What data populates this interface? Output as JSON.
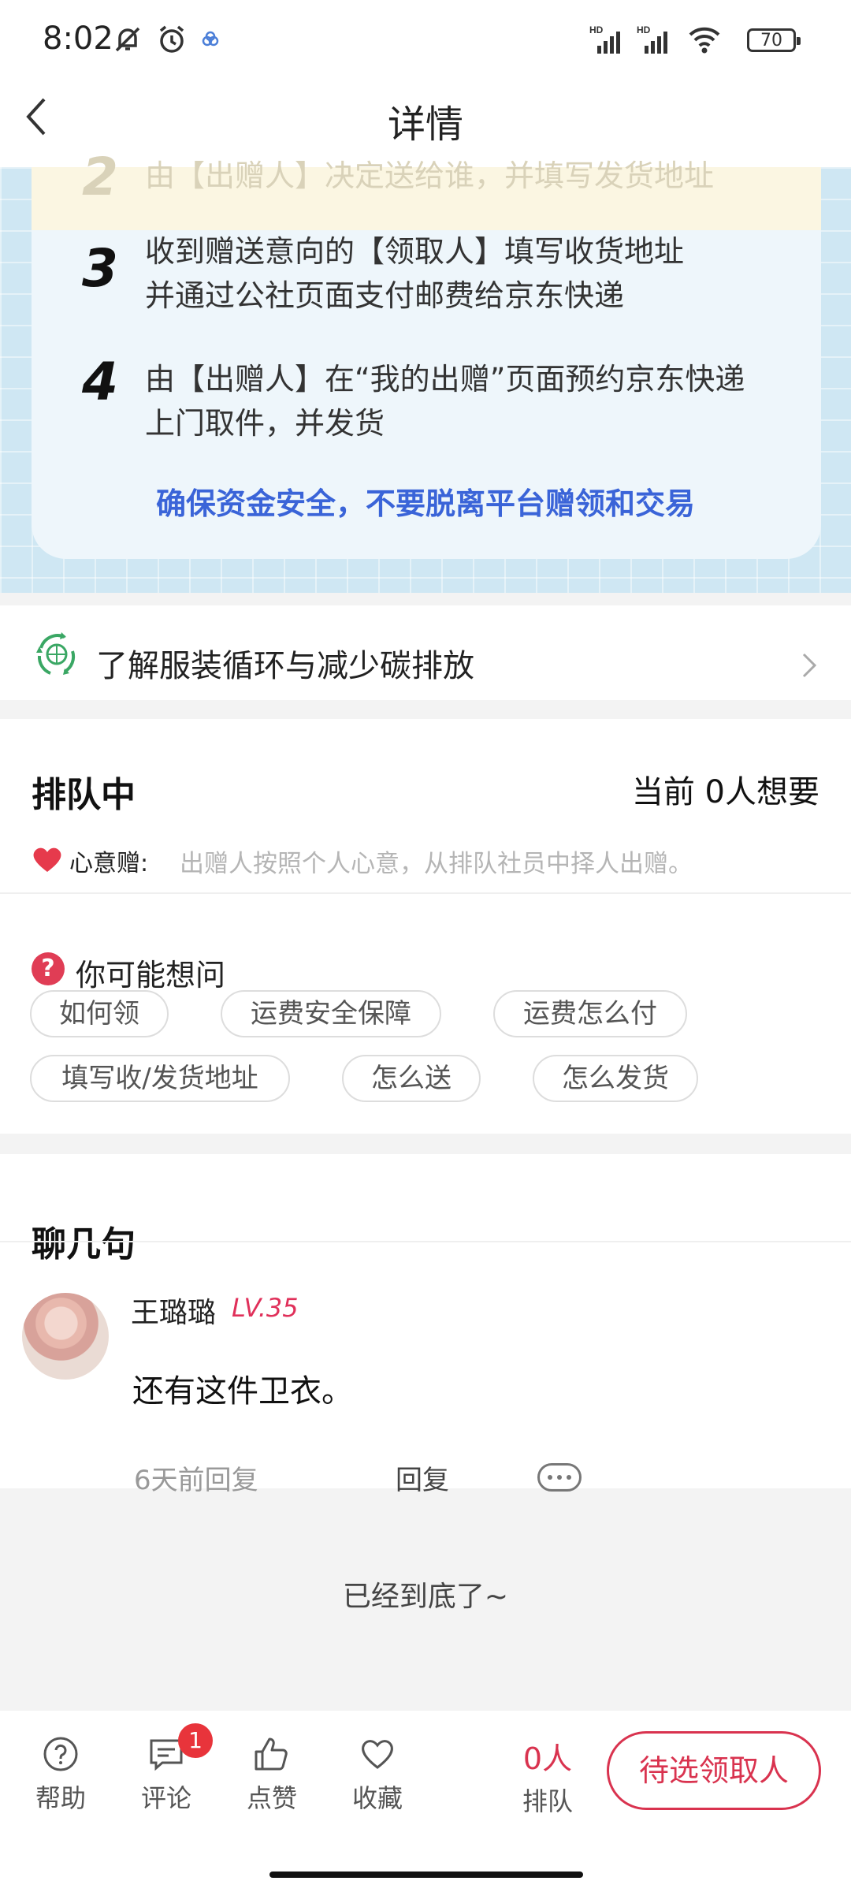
{
  "status": {
    "time": "8:02",
    "battery": "70"
  },
  "header": {
    "title": "详情"
  },
  "steps": {
    "step2": {
      "num": "2",
      "text": "由【出赠人】决定送给谁，并填写发货地址"
    },
    "step3": {
      "num": "3",
      "line1": "收到赠送意向的【领取人】填写收货地址",
      "line2": "并通过公社页面支付邮费给京东快递"
    },
    "step4": {
      "num": "4",
      "line1": "由【出赠人】在“我的出赠”页面预约京东快递",
      "line2": "上门取件，并发货"
    },
    "safety_notice": "确保资金安全，不要脱离平台赠领和交易"
  },
  "carbon": {
    "label": "了解服装循环与减少碳排放"
  },
  "queue": {
    "title": "排队中",
    "count_text": "当前 0人想要",
    "mode_label": "心意赠:",
    "mode_desc": "出赠人按照个人心意，从排队社员中择人出赠。"
  },
  "faq": {
    "title": "你可能想问",
    "chips": [
      "如何领",
      "运费安全保障",
      "运费怎么付",
      "填写收/发货地址",
      "怎么送",
      "怎么发货"
    ]
  },
  "chat": {
    "title": "聊几句",
    "comment": {
      "user": "王璐璐",
      "level": "LV.35",
      "text": "还有这件卫衣。",
      "time": "6天前回复",
      "reply_label": "回复"
    }
  },
  "end_text": "已经到底了~",
  "tabbar": {
    "help": "帮助",
    "comment": "评论",
    "comment_badge": "1",
    "like": "点赞",
    "favorite": "收藏",
    "queue_count": "0人",
    "queue_label": "排队",
    "cta": "待选领取人"
  },
  "colors": {
    "accent": "#d9334f",
    "safety_blue": "#3a64d8",
    "steps_bg": "#cfe7f3"
  }
}
